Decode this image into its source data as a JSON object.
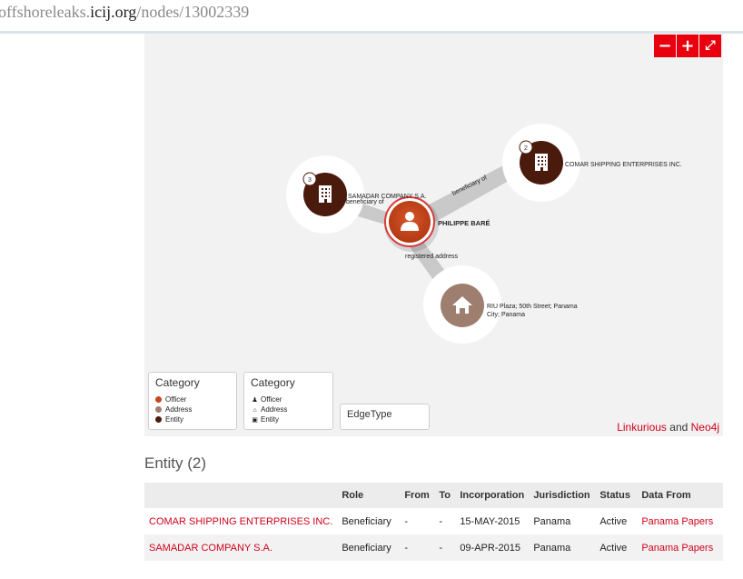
{
  "url": {
    "prefix": "offshoreleaks.",
    "domain": "icij.org",
    "path": "/nodes/13002339"
  },
  "zoom": {
    "minus": "−",
    "plus": "+",
    "fullscreen": "⤢"
  },
  "graph": {
    "nodes": [
      {
        "label": "PHILIPPE BARÉ",
        "type": "Officer",
        "color": "#c8471c"
      },
      {
        "label": "SAMADAR COMPANY S.A.",
        "type": "Entity",
        "badge": "3",
        "color": "#4a1a0c"
      },
      {
        "label": "COMAR SHIPPING ENTERPRISES INC.",
        "type": "Entity",
        "badge": "2",
        "color": "#4a1a0c"
      },
      {
        "label_line1": "RIU Plaza; 50th Street; Panama",
        "label_line2": "City; Panama",
        "type": "Address",
        "color": "#9e7f6f"
      }
    ],
    "edges": [
      "beneficiary of",
      "beneficiary of",
      "registered address"
    ]
  },
  "legend_color": {
    "title": "Category",
    "items": [
      {
        "label": "Officer",
        "color": "#c8471c"
      },
      {
        "label": "Address",
        "color": "#9e7f6f"
      },
      {
        "label": "Entity",
        "color": "#4a1a0c"
      }
    ]
  },
  "legend_icon": {
    "title": "Category",
    "items": [
      {
        "label": "Officer",
        "icon": "person-icon"
      },
      {
        "label": "Address",
        "icon": "home-icon"
      },
      {
        "label": "Entity",
        "icon": "building-icon"
      }
    ]
  },
  "legend_edge": {
    "title": "EdgeType"
  },
  "credit": {
    "link1": "Linkurious",
    "and": "and",
    "link2": "Neo4j"
  },
  "entity_section": {
    "title": "Entity (2)",
    "columns": [
      "",
      "Role",
      "From",
      "To",
      "Incorporation",
      "Jurisdiction",
      "Status",
      "Data From"
    ],
    "rows": [
      {
        "name": "COMAR SHIPPING ENTERPRISES INC.",
        "role": "Beneficiary",
        "from": "-",
        "to": "-",
        "incorporation": "15-MAY-2015",
        "jurisdiction": "Panama",
        "status": "Active",
        "source": "Panama Papers"
      },
      {
        "name": "SAMADAR COMPANY S.A.",
        "role": "Beneficiary",
        "from": "-",
        "to": "-",
        "incorporation": "09-APR-2015",
        "jurisdiction": "Panama",
        "status": "Active",
        "source": "Panama Papers"
      }
    ]
  }
}
